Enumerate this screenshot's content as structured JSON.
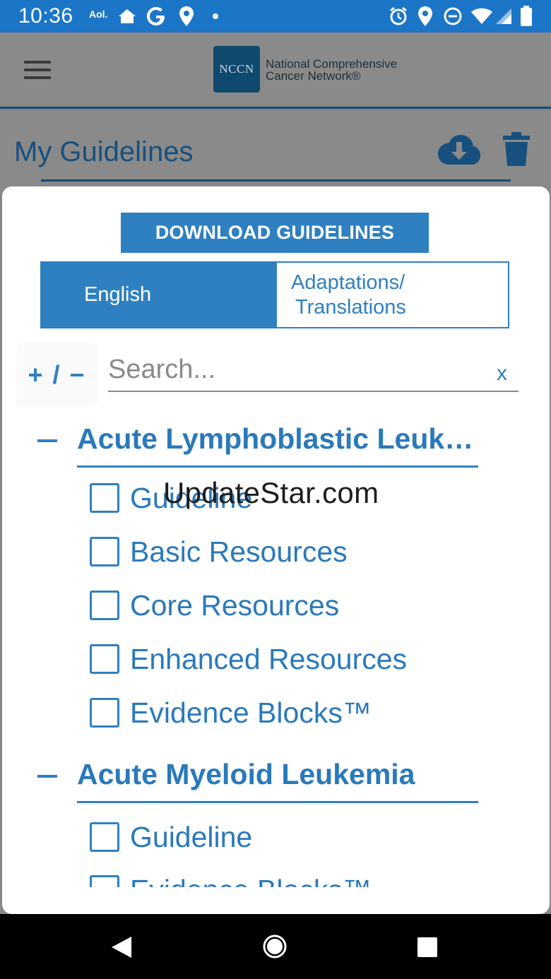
{
  "status_bar": {
    "time": "10:36",
    "aol_label": "Aol.",
    "left_icons": [
      "home-icon",
      "google-icon",
      "location-icon",
      "dot-icon"
    ],
    "right_icons": [
      "alarm-icon",
      "location-icon",
      "dnd-icon",
      "wifi-icon",
      "signal-icon",
      "battery-icon"
    ]
  },
  "header": {
    "menu_icon": "hamburger-icon",
    "logo_mark": "NCCN",
    "logo_line1": "National Comprehensive",
    "logo_line2": "Cancer Network®"
  },
  "page": {
    "title": "My Guidelines",
    "download_icon": "cloud-download-icon",
    "delete_icon": "trash-icon"
  },
  "modal": {
    "download_button": "DOWNLOAD GUIDELINES",
    "tabs": [
      {
        "label": "English",
        "active": true
      },
      {
        "label_line1": "Adaptations/",
        "label_line2": "Translations",
        "active": false
      }
    ],
    "expand_toggle": "+ / −",
    "search": {
      "placeholder": "Search...",
      "value": "",
      "clear_label": "x"
    },
    "sections": [
      {
        "title": "Acute Lymphoblastic Leuk…",
        "items": [
          "Guideline",
          "Basic Resources",
          "Core Resources",
          "Enhanced Resources",
          "Evidence Blocks™"
        ]
      },
      {
        "title": "Acute Myeloid Leukemia",
        "items": [
          "Guideline",
          "Evidence Blocks™"
        ]
      }
    ]
  },
  "watermark": "UpdateStar.com",
  "colors": {
    "status_bar": "#1c76c8",
    "accent": "#2f80c0",
    "dim_overlay": "#8a8a8a",
    "header_line": "#174a7a"
  }
}
